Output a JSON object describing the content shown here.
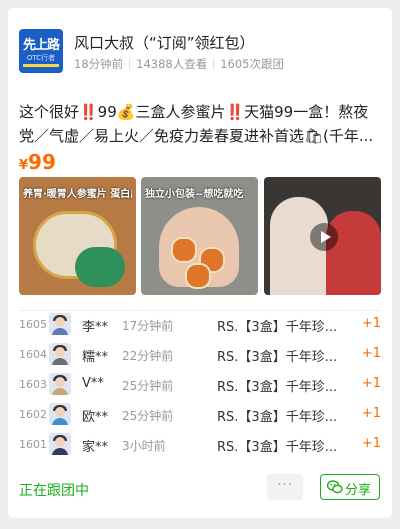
{
  "group": {
    "avatar_line1": "先上路",
    "avatar_line2": "OTC行者",
    "title": "风口大叔（“订阅”领红包）",
    "posted": "18分钟前",
    "views": "14388人查看",
    "joins": "1605次跟团"
  },
  "product": {
    "description": "这个很好‼️99💰三盒人参蜜片‼️天猫99一盒！熬夜党／气虚／易上火／免疫力差春夏进补首选🛍(千年...",
    "currency": "¥",
    "price": "99",
    "images": [
      {
        "caption": "养胃·暖胃人参蜜片 蛋白质含量",
        "icon": "product-photo"
      },
      {
        "caption": "独立小包装~想吃就吃",
        "icon": "product-photo"
      },
      {
        "caption": "",
        "icon": "video-thumbnail"
      }
    ]
  },
  "orders": [
    {
      "no": "1605",
      "name": "李**",
      "time": "17分钟前",
      "item": "RS.【3盒】千年珍...",
      "qty": "+1"
    },
    {
      "no": "1604",
      "name": "糯**",
      "time": "22分钟前",
      "item": "RS.【3盒】千年珍...",
      "qty": "+1"
    },
    {
      "no": "1603",
      "name": "V**",
      "time": "25分钟前",
      "item": "RS.【3盒】千年珍...",
      "qty": "+1"
    },
    {
      "no": "1602",
      "name": "欧**",
      "time": "25分钟前",
      "item": "RS.【3盒】千年珍...",
      "qty": "+1"
    },
    {
      "no": "1601",
      "name": "家**",
      "time": "3小时前",
      "item": "RS.【3盒】千年珍...",
      "qty": "+1"
    }
  ],
  "footer": {
    "status": "正在跟团中",
    "more": "···",
    "share": "分享"
  },
  "colors": {
    "accent": "#1aad19",
    "price": "#ff6a00",
    "muted": "#999999"
  }
}
